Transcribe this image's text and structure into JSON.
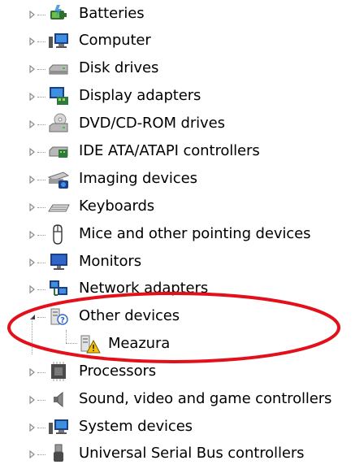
{
  "tree": {
    "categories": [
      {
        "label": "Batteries",
        "icon": "battery-icon",
        "state": "collapsed"
      },
      {
        "label": "Computer",
        "icon": "computer-icon",
        "state": "collapsed"
      },
      {
        "label": "Disk drives",
        "icon": "disk-drive-icon",
        "state": "collapsed"
      },
      {
        "label": "Display adapters",
        "icon": "display-adapter-icon",
        "state": "collapsed"
      },
      {
        "label": "DVD/CD-ROM drives",
        "icon": "dvd-drive-icon",
        "state": "collapsed"
      },
      {
        "label": "IDE ATA/ATAPI controllers",
        "icon": "ide-controller-icon",
        "state": "collapsed"
      },
      {
        "label": "Imaging devices",
        "icon": "imaging-device-icon",
        "state": "collapsed"
      },
      {
        "label": "Keyboards",
        "icon": "keyboard-icon",
        "state": "collapsed"
      },
      {
        "label": "Mice and other pointing devices",
        "icon": "mouse-icon",
        "state": "collapsed"
      },
      {
        "label": "Monitors",
        "icon": "monitor-icon",
        "state": "collapsed"
      },
      {
        "label": "Network adapters",
        "icon": "network-adapter-icon",
        "state": "collapsed"
      },
      {
        "label": "Other devices",
        "icon": "unknown-device-icon",
        "state": "expanded"
      },
      {
        "label": "Meazura",
        "icon": "warning-device-icon",
        "state": "leaf",
        "child": true
      },
      {
        "label": "Processors",
        "icon": "processor-icon",
        "state": "collapsed"
      },
      {
        "label": "Sound, video and game controllers",
        "icon": "speaker-icon",
        "state": "collapsed"
      },
      {
        "label": "System devices",
        "icon": "system-device-icon",
        "state": "collapsed"
      },
      {
        "label": "Universal Serial Bus controllers",
        "icon": "usb-icon",
        "state": "collapsed"
      }
    ]
  },
  "colors": {
    "annotation_circle": "#e3101c",
    "warning": "#f4c20d",
    "tree_arrow": "#8c8c8c"
  }
}
